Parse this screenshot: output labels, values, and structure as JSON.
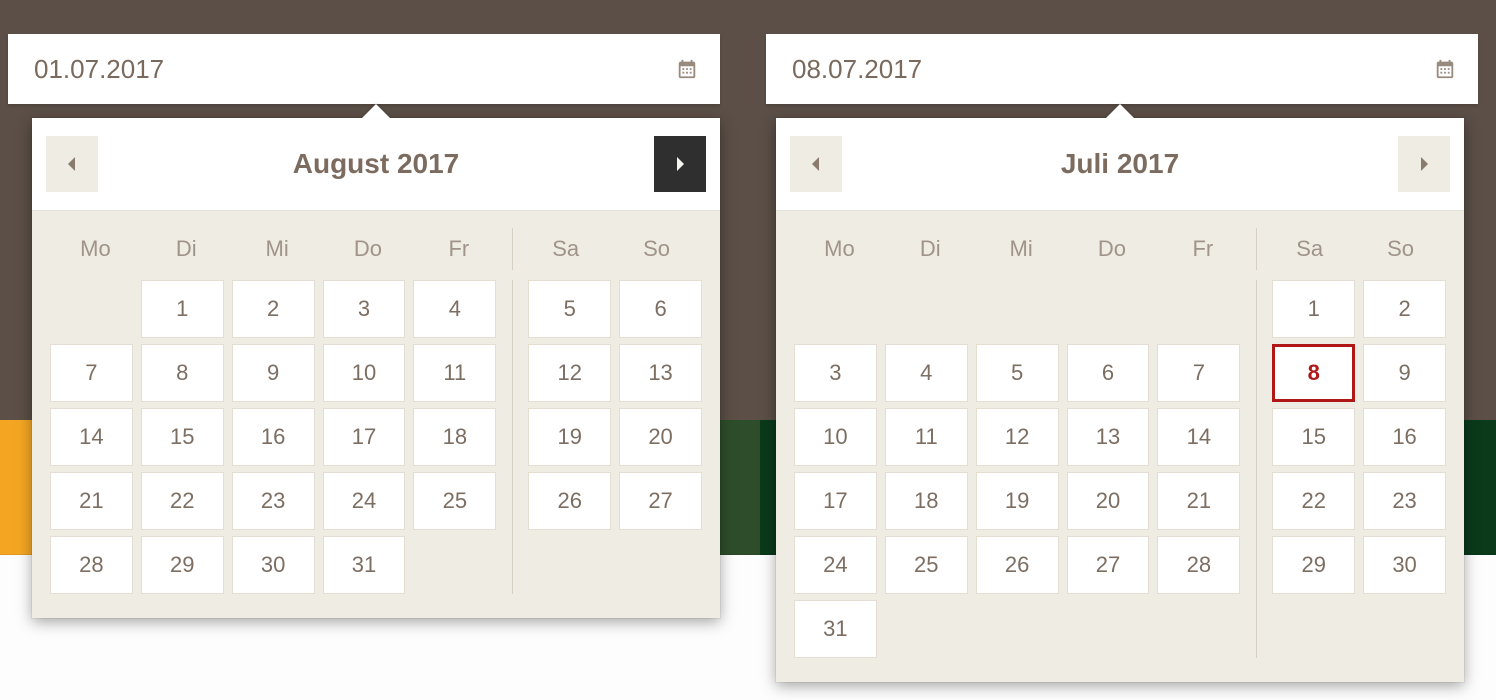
{
  "left_input": {
    "value": "01.07.2017"
  },
  "right_input": {
    "value": "08.07.2017"
  },
  "dow": {
    "0": "Mo",
    "1": "Di",
    "2": "Mi",
    "3": "Do",
    "4": "Fr",
    "5": "Sa",
    "6": "So"
  },
  "left_cal": {
    "title": "August 2017",
    "days": [
      {
        "n": "",
        "col": 1
      },
      {
        "n": "1",
        "col": 2
      },
      {
        "n": "2",
        "col": 3
      },
      {
        "n": "3",
        "col": 4
      },
      {
        "n": "4",
        "col": 5
      },
      {
        "n": "5",
        "col": 7
      },
      {
        "n": "6",
        "col": 8
      },
      {
        "n": "7",
        "col": 1
      },
      {
        "n": "8",
        "col": 2
      },
      {
        "n": "9",
        "col": 3
      },
      {
        "n": "10",
        "col": 4
      },
      {
        "n": "11",
        "col": 5
      },
      {
        "n": "12",
        "col": 7
      },
      {
        "n": "13",
        "col": 8
      },
      {
        "n": "14",
        "col": 1
      },
      {
        "n": "15",
        "col": 2
      },
      {
        "n": "16",
        "col": 3
      },
      {
        "n": "17",
        "col": 4
      },
      {
        "n": "18",
        "col": 5
      },
      {
        "n": "19",
        "col": 7
      },
      {
        "n": "20",
        "col": 8
      },
      {
        "n": "21",
        "col": 1
      },
      {
        "n": "22",
        "col": 2
      },
      {
        "n": "23",
        "col": 3
      },
      {
        "n": "24",
        "col": 4
      },
      {
        "n": "25",
        "col": 5
      },
      {
        "n": "26",
        "col": 7
      },
      {
        "n": "27",
        "col": 8
      },
      {
        "n": "28",
        "col": 1
      },
      {
        "n": "29",
        "col": 2
      },
      {
        "n": "30",
        "col": 3
      },
      {
        "n": "31",
        "col": 4
      }
    ]
  },
  "right_cal": {
    "title": "Juli 2017",
    "selected": "8",
    "days": [
      {
        "n": "",
        "col": 1
      },
      {
        "n": "",
        "col": 2
      },
      {
        "n": "",
        "col": 3
      },
      {
        "n": "",
        "col": 4
      },
      {
        "n": "",
        "col": 5
      },
      {
        "n": "1",
        "col": 7
      },
      {
        "n": "2",
        "col": 8
      },
      {
        "n": "3",
        "col": 1
      },
      {
        "n": "4",
        "col": 2
      },
      {
        "n": "5",
        "col": 3
      },
      {
        "n": "6",
        "col": 4
      },
      {
        "n": "7",
        "col": 5
      },
      {
        "n": "8",
        "col": 7
      },
      {
        "n": "9",
        "col": 8
      },
      {
        "n": "10",
        "col": 1
      },
      {
        "n": "11",
        "col": 2
      },
      {
        "n": "12",
        "col": 3
      },
      {
        "n": "13",
        "col": 4
      },
      {
        "n": "14",
        "col": 5
      },
      {
        "n": "15",
        "col": 7
      },
      {
        "n": "16",
        "col": 8
      },
      {
        "n": "17",
        "col": 1
      },
      {
        "n": "18",
        "col": 2
      },
      {
        "n": "19",
        "col": 3
      },
      {
        "n": "20",
        "col": 4
      },
      {
        "n": "21",
        "col": 5
      },
      {
        "n": "22",
        "col": 7
      },
      {
        "n": "23",
        "col": 8
      },
      {
        "n": "24",
        "col": 1
      },
      {
        "n": "25",
        "col": 2
      },
      {
        "n": "26",
        "col": 3
      },
      {
        "n": "27",
        "col": 4
      },
      {
        "n": "28",
        "col": 5
      },
      {
        "n": "29",
        "col": 7
      },
      {
        "n": "30",
        "col": 8
      },
      {
        "n": "31",
        "col": 1
      }
    ]
  }
}
